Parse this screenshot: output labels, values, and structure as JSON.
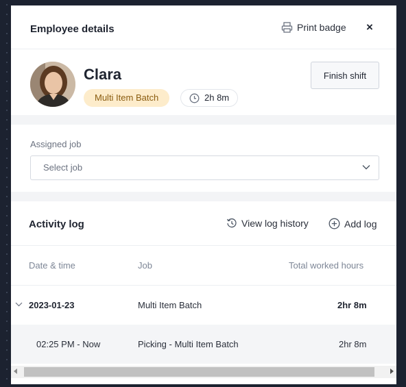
{
  "header": {
    "title": "Employee details",
    "print_label": "Print badge",
    "close_symbol": "×"
  },
  "employee": {
    "name": "Clara",
    "job_badge": "Multi Item Batch",
    "time_badge": "2h 8m",
    "finish_label": "Finish shift"
  },
  "assigned_job": {
    "label": "Assigned job",
    "placeholder": "Select job"
  },
  "activity_log": {
    "title": "Activity log",
    "view_history_label": "View log history",
    "add_label": "Add log",
    "columns": [
      "Date & time",
      "Job",
      "Total worked hours"
    ],
    "rows": [
      {
        "date": "2023-01-23",
        "job": "Multi Item Batch",
        "hours": "2hr 8m"
      },
      {
        "date": "02:25 PM - Now",
        "job": "Picking - Multi Item Batch",
        "hours": "2hr 8m"
      }
    ]
  },
  "colors": {
    "job_badge_bg": "#fdeccb",
    "job_badge_text": "#8a5c0f",
    "frame_bg": "#1c2230"
  },
  "icons": {
    "print": "printer-icon",
    "close": "close-icon",
    "clock": "clock-icon",
    "chevron": "chevron-down-icon",
    "history": "history-icon",
    "add": "plus-circle-icon",
    "expand": "chevron-expand-icon"
  }
}
